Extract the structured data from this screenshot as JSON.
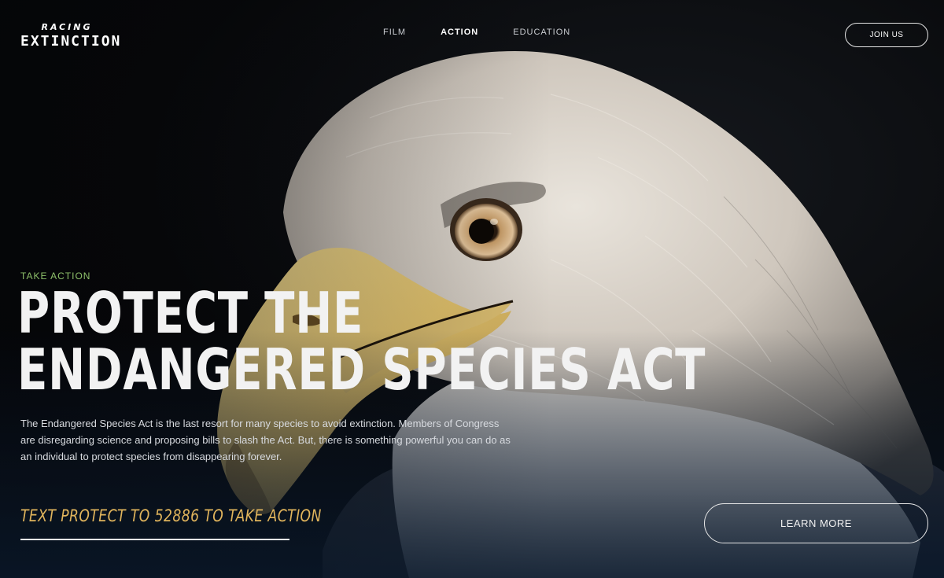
{
  "header": {
    "logo_top": "RACING",
    "logo_main": "EXTINCTION",
    "nav": [
      {
        "label": "FILM"
      },
      {
        "label": "ACTION"
      },
      {
        "label": "EDUCATION"
      }
    ],
    "active_nav": "ACTION",
    "join_label": "JOIN US"
  },
  "hero": {
    "eyebrow": "TAKE ACTION",
    "headline_line1": "PROTECT THE",
    "headline_line2": "ENDANGERED SPECIES ACT",
    "body": "The Endangered Species Act is the last resort for many species to avoid extinction. Members of Congress are disregarding science and proposing bills to slash the Act. But, there is something powerful you can do as an individual to protect species from disappearing forever.",
    "cta_text": "TEXT PROTECT TO 52886 TO TAKE ACTION",
    "learn_more_label": "LEARN MORE"
  },
  "colors": {
    "eyebrow": "#8ec06a",
    "cta": "#e0b45c",
    "background": "#050608"
  }
}
